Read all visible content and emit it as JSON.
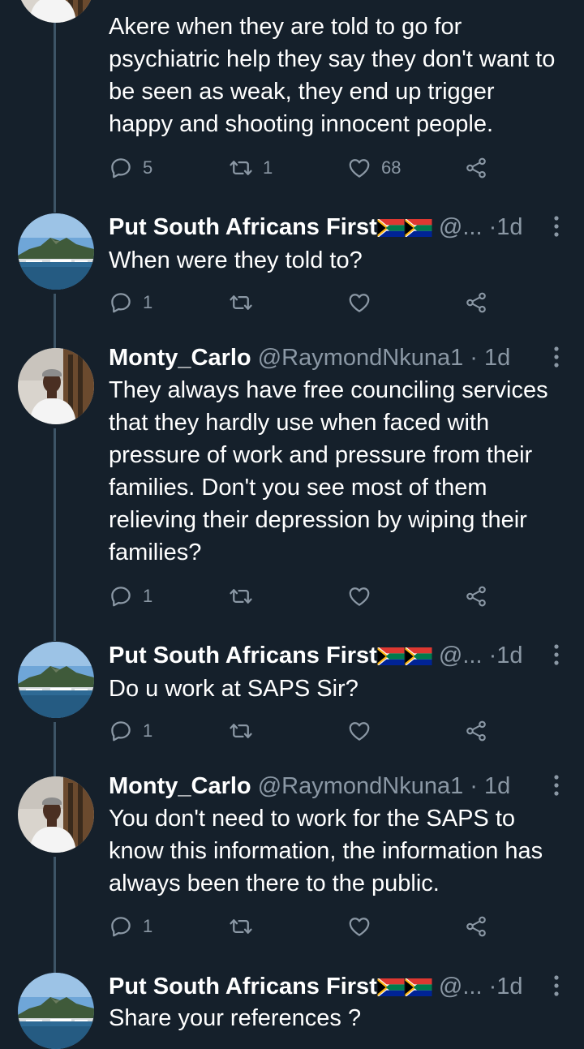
{
  "tweets": [
    {
      "text": "Akere when they are told to go for psychiatric help they say they don't want to be seen as weak, they end up trigger happy and shooting innocent people.",
      "replies": "5",
      "retweets": "1",
      "likes": "68"
    },
    {
      "name": "Put South Africans First",
      "handle": "@...",
      "time": "1d",
      "text": "When were they told to?",
      "replies": "1",
      "retweets": "",
      "likes": ""
    },
    {
      "name": "Monty_Carlo",
      "handle": "@RaymondNkuna1",
      "time": "1d",
      "text": "They always have free counciling services that they hardly use when faced with pressure of work and pressure from their families. Don't you see most of them relieving their depression by wiping their families?",
      "replies": "1",
      "retweets": "",
      "likes": ""
    },
    {
      "name": "Put South Africans First",
      "handle": "@...",
      "time": "1d",
      "text": "Do u work at SAPS Sir?",
      "replies": "1",
      "retweets": "",
      "likes": ""
    },
    {
      "name": "Monty_Carlo",
      "handle": "@RaymondNkuna1",
      "time": "1d",
      "text": "You don't need to work for the SAPS to know this information,  the information has always been there to the public.",
      "replies": "1",
      "retweets": "",
      "likes": ""
    },
    {
      "name": "Put South Africans First",
      "handle": "@...",
      "time": "1d",
      "text": "Share your references ?",
      "replies": "",
      "retweets": "",
      "likes": ""
    }
  ],
  "separator": "·",
  "colors": {
    "background": "#15202b",
    "text": "#ffffff",
    "secondary": "#8b98a5",
    "thread_line": "#3d5466"
  },
  "icons": {
    "reply": "reply-icon",
    "retweet": "retweet-icon",
    "like": "heart-icon",
    "share": "share-icon",
    "more": "more-vertical-icon",
    "flag": "south-africa-flag-icon"
  }
}
